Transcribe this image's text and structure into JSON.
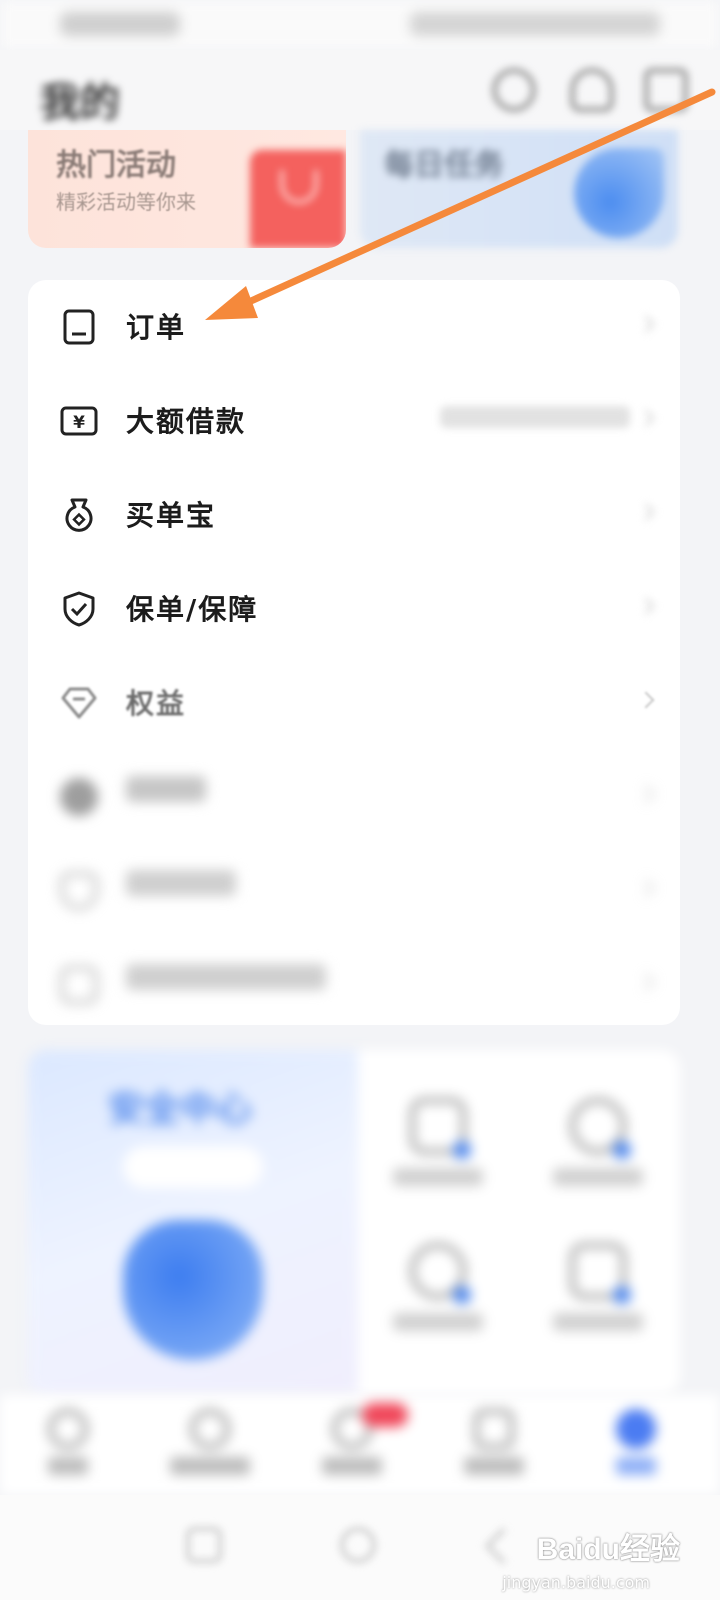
{
  "status_bar": {
    "left": "",
    "right": ""
  },
  "header": {
    "title": "我的",
    "icons": [
      "settings-icon",
      "headset-icon",
      "menu-icon"
    ]
  },
  "banners": [
    {
      "title": "热门活动",
      "subtitle": "精彩活动等你来"
    },
    {
      "title": "每日任务",
      "subtitle": ""
    }
  ],
  "menu": {
    "items": [
      {
        "label": "订单",
        "icon": "document-icon",
        "value": ""
      },
      {
        "label": "大额借款",
        "icon": "yen-card-icon",
        "value": ""
      },
      {
        "label": "买单宝",
        "icon": "money-bag-icon",
        "value": ""
      },
      {
        "label": "保单/保障",
        "icon": "shield-check-icon",
        "value": ""
      },
      {
        "label": "权益",
        "icon": "diamond-icon",
        "value": ""
      },
      {
        "label": "",
        "icon": "circle-icon",
        "value": ""
      },
      {
        "label": "",
        "icon": "shield-icon",
        "value": ""
      },
      {
        "label": "",
        "icon": "lock-icon",
        "value": ""
      }
    ]
  },
  "security": {
    "title": "安全中心",
    "button": "",
    "tiles": [
      {
        "label": ""
      },
      {
        "label": ""
      },
      {
        "label": ""
      },
      {
        "label": ""
      }
    ]
  },
  "bottom_nav": {
    "items": [
      {
        "label": "",
        "icon": "home-icon"
      },
      {
        "label": "",
        "icon": "wallet-icon"
      },
      {
        "label": "",
        "icon": "gift-icon"
      },
      {
        "label": "",
        "icon": "bag-icon"
      },
      {
        "label": "",
        "icon": "profile-icon"
      }
    ]
  },
  "watermark": {
    "text": "Baidu经验",
    "sub": "jingyan.baidu.com"
  },
  "colors": {
    "accent": "#4b7cf2",
    "arrow": "#f5893b"
  }
}
